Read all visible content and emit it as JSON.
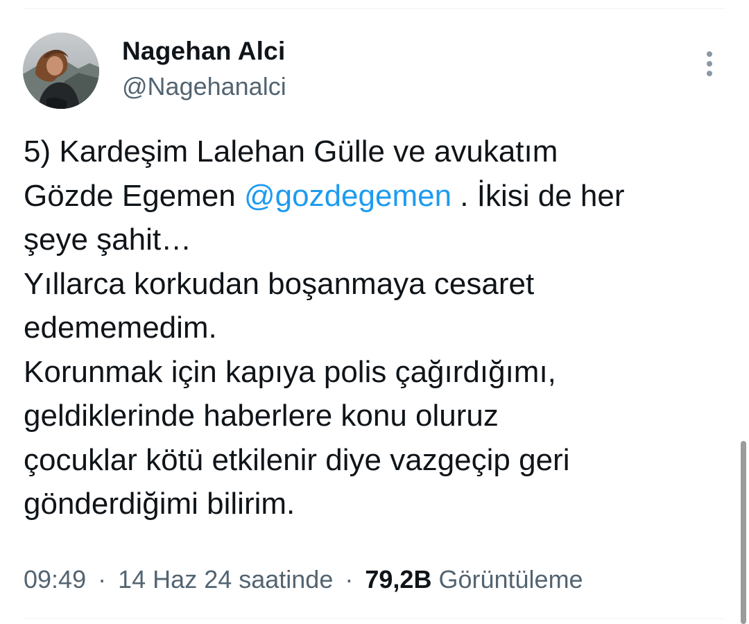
{
  "author": {
    "display_name": "Nagehan Alci",
    "handle": "@Nagehanalci",
    "avatar": "profile-photo"
  },
  "menu": {
    "icon": "more-vertical-icon"
  },
  "tweet": {
    "lines": [
      "5) Kardeşim Lalehan Gülle ve avukatım",
      "Gözde Egemen ",
      "şeye şahit…",
      "Yıllarca korkudan boşanmaya cesaret",
      "edememedim.",
      "Korunmak için kapıya polis çağırdığımı,",
      "geldiklerinde haberlere konu oluruz",
      "çocuklar kötü etkilenir diye vazgeçip geri",
      "gönderdiğimi bilirim."
    ],
    "mention": "@gozdegemen",
    "after_mention": " . İkisi de her"
  },
  "meta": {
    "time": "09:49",
    "separator": "·",
    "date": "14 Haz 24 saatinde",
    "views_count": "79,2B",
    "views_label": "Görüntüleme"
  },
  "colors": {
    "text": "#0f1419",
    "secondary": "#536471",
    "link": "#1d9bf0",
    "divider": "#eff3f4"
  }
}
